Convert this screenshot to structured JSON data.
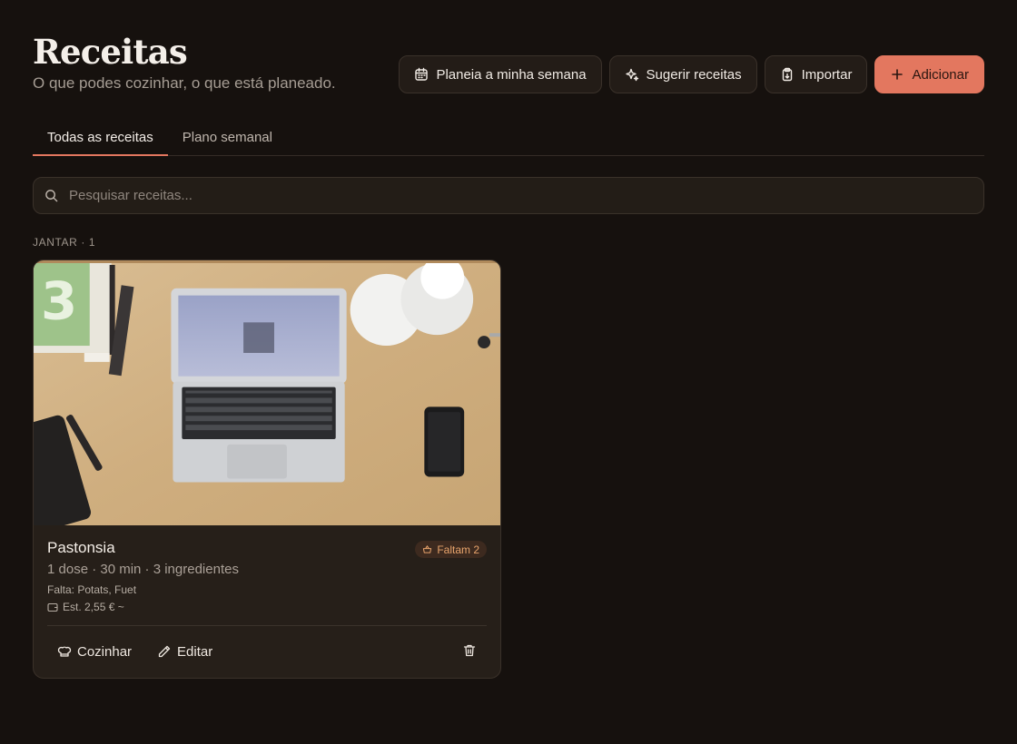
{
  "header": {
    "title": "Receitas",
    "subtitle": "O que podes cozinhar, o que está planeado."
  },
  "actions": {
    "plan_week": "Planeia a minha semana",
    "suggest": "Sugerir receitas",
    "import": "Importar",
    "add": "Adicionar"
  },
  "tabs": [
    {
      "label": "Todas as receitas",
      "active": true
    },
    {
      "label": "Plano semanal",
      "active": false
    }
  ],
  "search": {
    "placeholder": "Pesquisar receitas...",
    "value": ""
  },
  "section": {
    "label": "JANTAR · 1"
  },
  "recipes": [
    {
      "title": "Pastonsia",
      "meta": "1 dose · 30 min · 3 ingredientes",
      "missing": "Falta: Potats, Fuet",
      "cost": "Est. 2,55 € ~",
      "badge": "Faltam 2",
      "cook_label": "Cozinhar",
      "edit_label": "Editar"
    }
  ],
  "colors": {
    "background": "#16110e",
    "accent": "#e3775f",
    "card": "#261f19",
    "badge_text": "#e8a46c"
  },
  "icons": [
    "calendar-icon",
    "sparkles-icon",
    "clipboard-icon",
    "plus-icon",
    "search-icon",
    "basket-icon",
    "wallet-icon",
    "chef-hat-icon",
    "pencil-icon",
    "trash-icon"
  ]
}
